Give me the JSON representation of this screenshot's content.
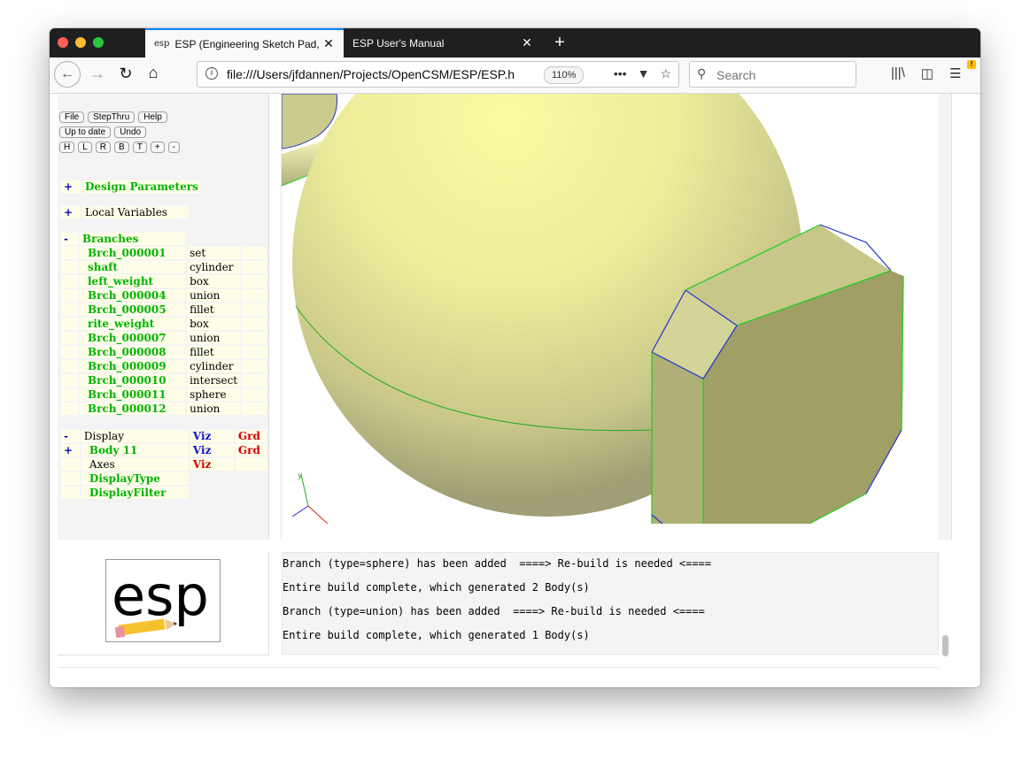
{
  "browser": {
    "tabs": [
      {
        "favicon": "esp",
        "title": "ESP (Engineering Sketch Pad, V",
        "close": "✕"
      },
      {
        "title": "ESP User's Manual",
        "close": "✕"
      }
    ],
    "new_tab": "+",
    "url": "file:///Users/jfdannen/Projects/OpenCSM/ESP/ESP.h",
    "zoom": "110%",
    "search_placeholder": "Search",
    "notification_badge": "!"
  },
  "toolbar": {
    "row1": [
      "File",
      "StepThru",
      "Help"
    ],
    "row2": [
      "Up to date",
      "Undo"
    ],
    "row3": [
      "H",
      "L",
      "R",
      "B",
      "T",
      "+",
      "-"
    ]
  },
  "tree": {
    "design_parameters": {
      "sign": "+",
      "label": "Design Parameters"
    },
    "local_variables": {
      "sign": "+",
      "label": "Local Variables"
    },
    "branches_header": {
      "sign": "-",
      "label": "Branches"
    },
    "branches": [
      {
        "name": "Brch_000001",
        "type": "set"
      },
      {
        "name": "shaft",
        "type": "cylinder"
      },
      {
        "name": "left_weight",
        "type": "box"
      },
      {
        "name": "Brch_000004",
        "type": "union"
      },
      {
        "name": "Brch_000005",
        "type": "fillet"
      },
      {
        "name": "rite_weight",
        "type": "box"
      },
      {
        "name": "Brch_000007",
        "type": "union"
      },
      {
        "name": "Brch_000008",
        "type": "fillet"
      },
      {
        "name": "Brch_000009",
        "type": "cylinder"
      },
      {
        "name": "Brch_000010",
        "type": "intersect"
      },
      {
        "name": "Brch_000011",
        "type": "sphere"
      },
      {
        "name": "Brch_000012",
        "type": "union"
      }
    ],
    "display": {
      "sign": "-",
      "label": "Display",
      "viz": "Viz",
      "grd": "Grd"
    },
    "body": {
      "sign": "+",
      "label": "Body 11",
      "viz": "Viz",
      "grd": "Grd"
    },
    "axes": {
      "label": "Axes",
      "viz": "Viz"
    },
    "display_type": {
      "label": "DisplayType"
    },
    "display_filter": {
      "label": "DisplayFilter"
    }
  },
  "logo": {
    "text": "esp"
  },
  "messages": [
    "Branch (type=sphere) has been added  ====> Re-build is needed <====",
    "Entire build complete, which generated 2 Body(s)",
    "Branch (type=union) has been added  ====> Re-build is needed <====",
    "Entire build complete, which generated 1 Body(s)"
  ],
  "colors": {
    "tree_bg": "#fefee8",
    "green_label": "#00b300",
    "blue_label": "#1010cc",
    "red_label": "#d00000",
    "accent": "#0a84ff"
  }
}
